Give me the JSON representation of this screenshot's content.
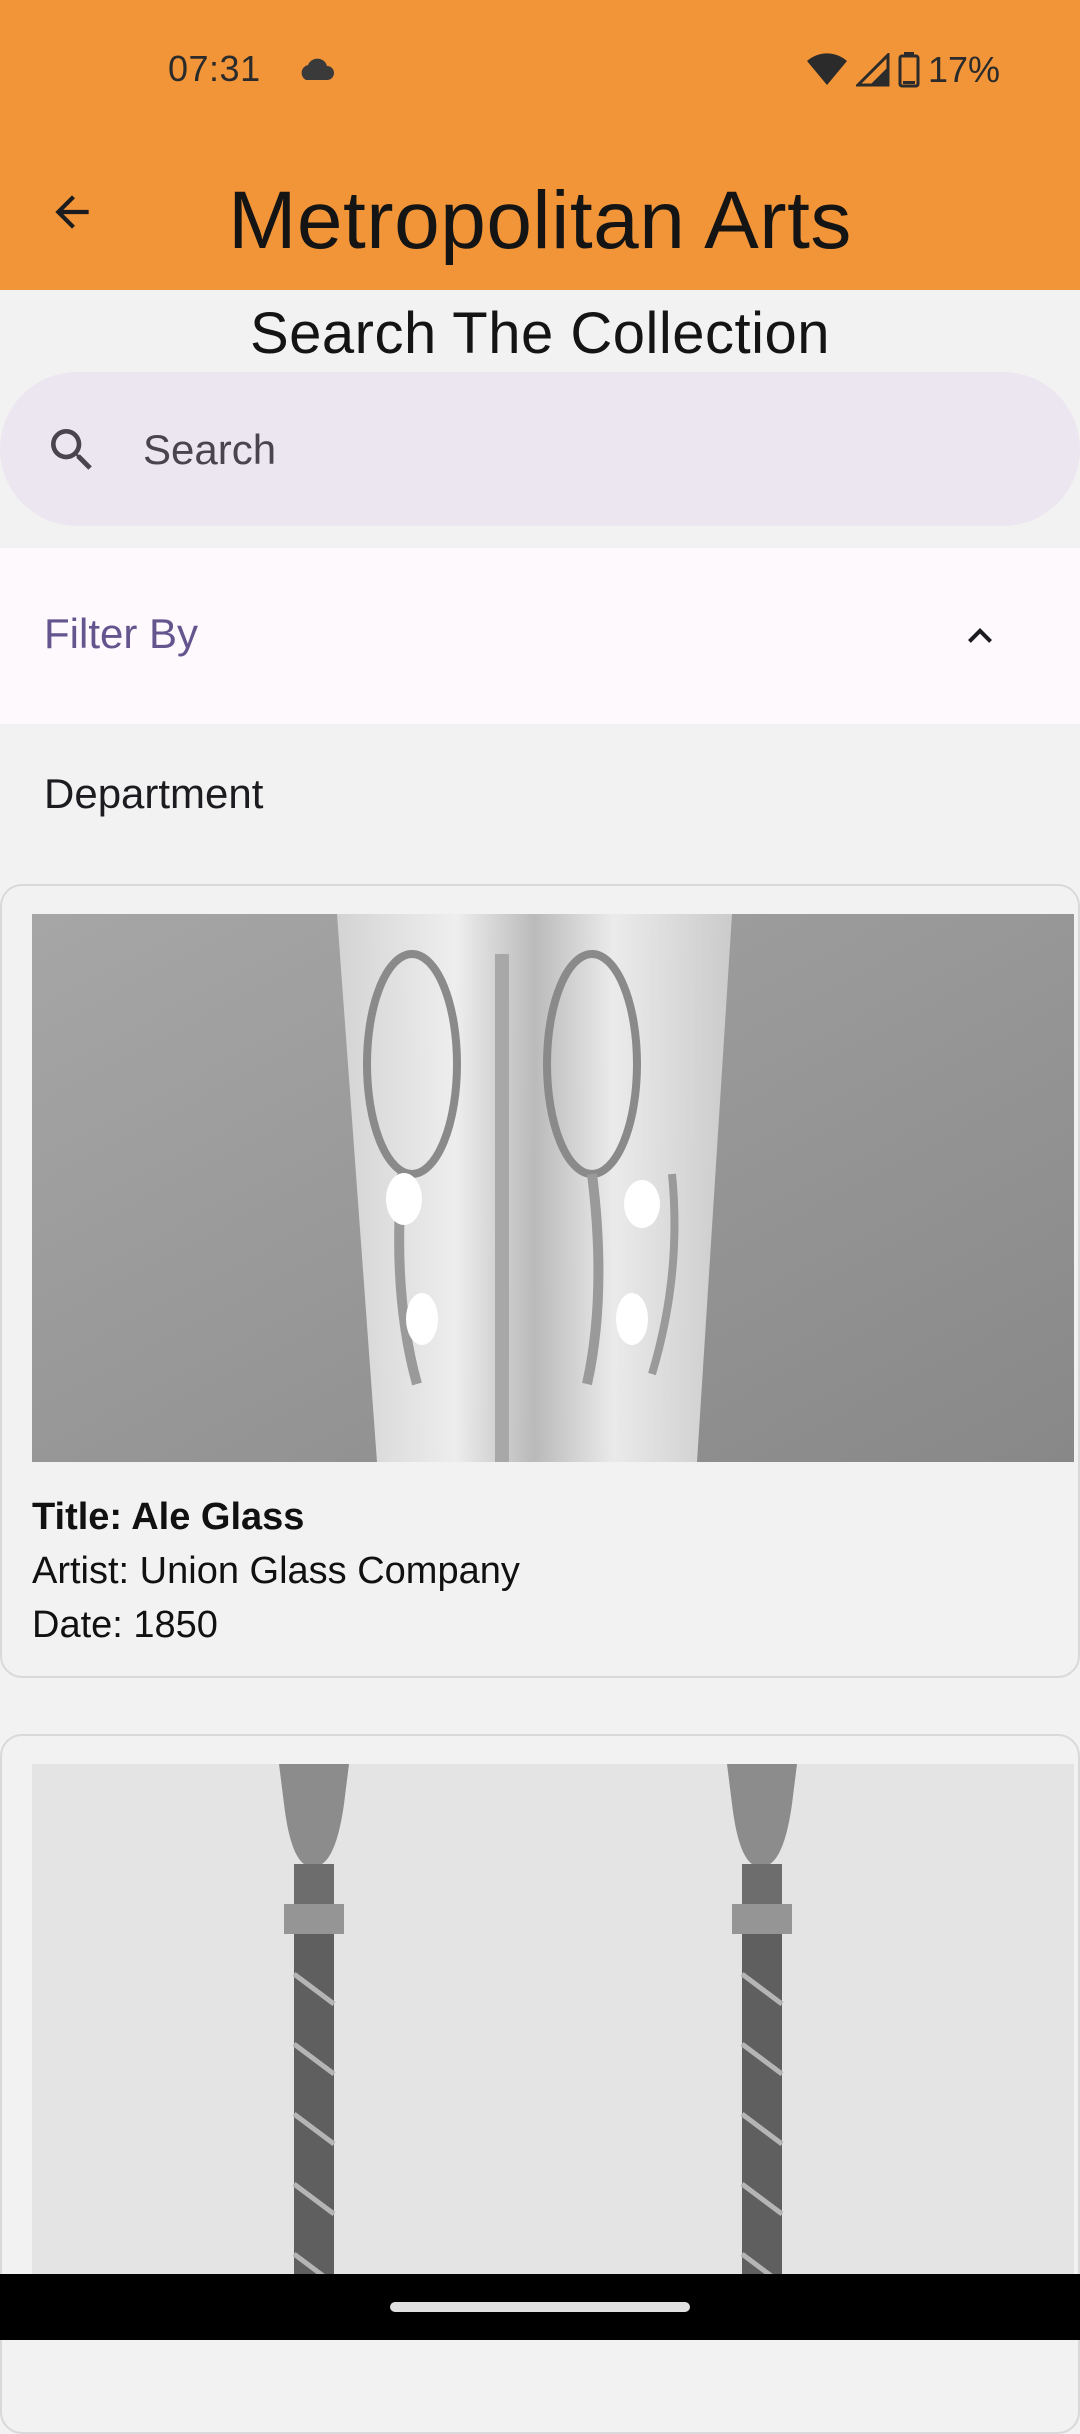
{
  "status_bar": {
    "time": "07:31",
    "battery": "17%"
  },
  "app_bar": {
    "title": "Metropolitan Arts"
  },
  "page": {
    "heading": "Search The Collection"
  },
  "search": {
    "placeholder": "Search"
  },
  "filter": {
    "label": "Filter By",
    "department_label": "Department"
  },
  "results": [
    {
      "title": "Title: Ale Glass",
      "artist": "Artist: Union Glass Company",
      "date": "Date: 1850"
    },
    {
      "title": "",
      "artist": "",
      "date": ""
    }
  ],
  "colors": {
    "app_bar": "#f29539",
    "search_bg": "#ece6f0",
    "filter_accent": "#65558f"
  },
  "icons": [
    "cloud-icon",
    "wifi-icon",
    "signal-icon",
    "battery-icon",
    "back-arrow-icon",
    "search-icon",
    "chevron-up-icon"
  ]
}
